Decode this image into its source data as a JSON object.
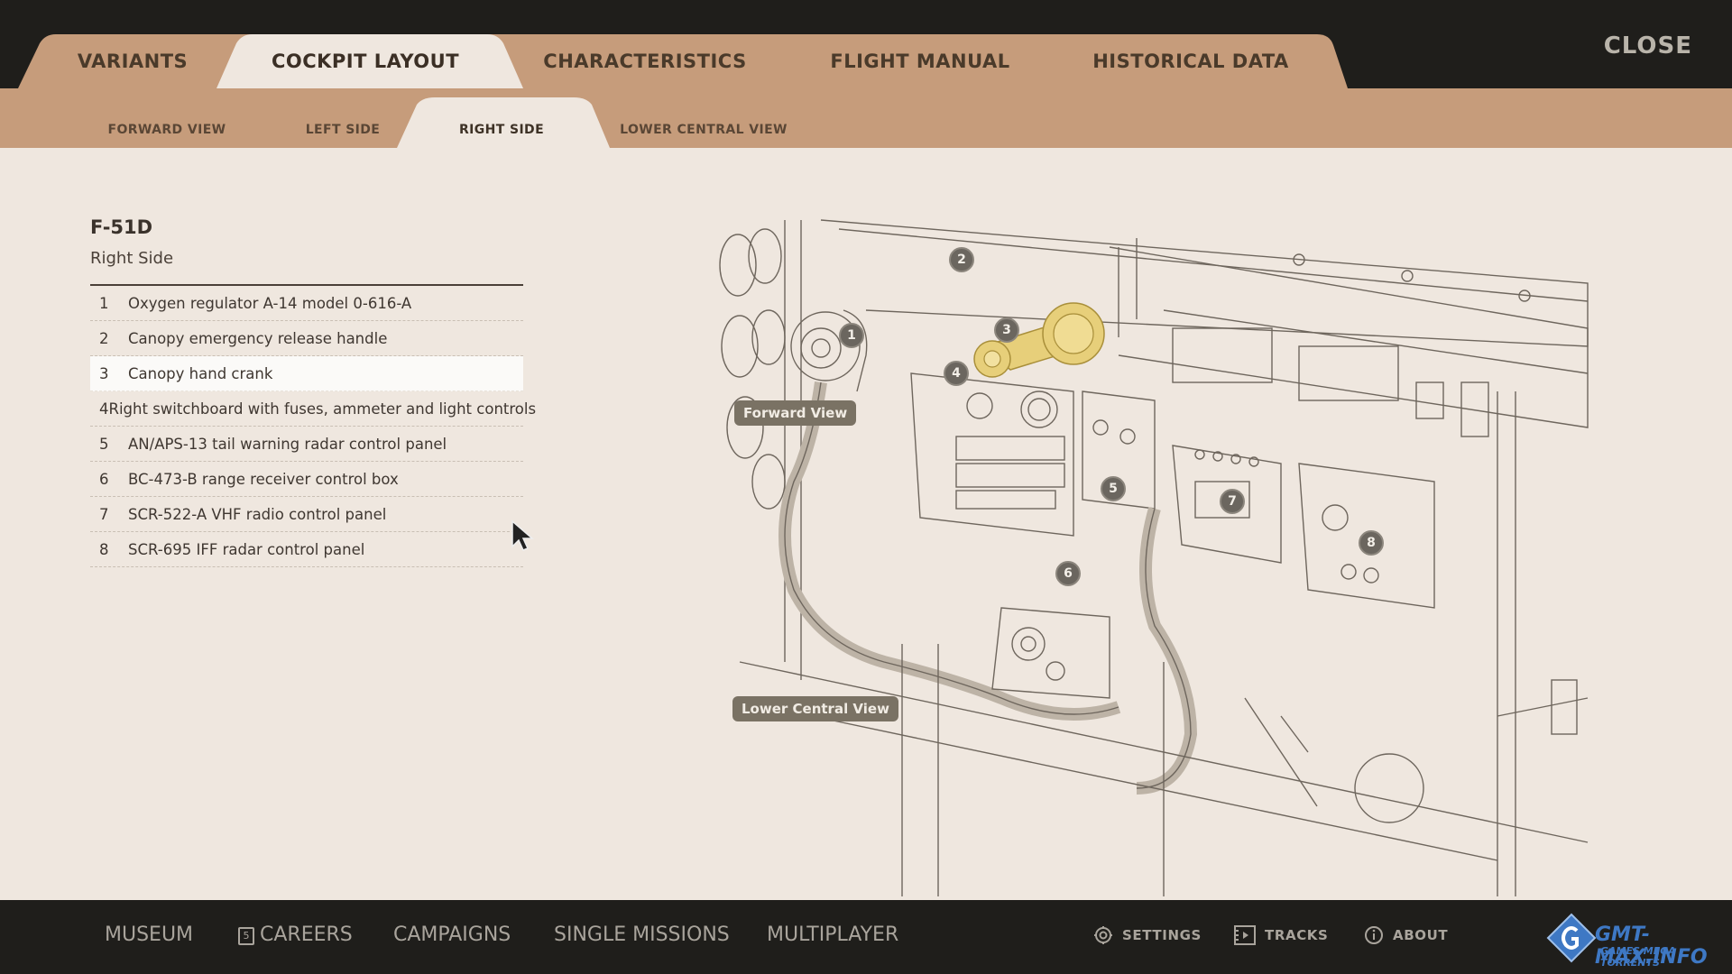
{
  "header": {
    "tabs": [
      {
        "label": "VARIANTS",
        "active": false
      },
      {
        "label": "COCKPIT LAYOUT",
        "active": true
      },
      {
        "label": "CHARACTERISTICS",
        "active": false
      },
      {
        "label": "FLIGHT MANUAL",
        "active": false
      },
      {
        "label": "HISTORICAL DATA",
        "active": false
      }
    ],
    "close_label": "CLOSE"
  },
  "subtabs": [
    {
      "label": "FORWARD VIEW",
      "active": false
    },
    {
      "label": "LEFT SIDE",
      "active": false
    },
    {
      "label": "RIGHT SIDE",
      "active": true
    },
    {
      "label": "LOWER CENTRAL VIEW",
      "active": false
    }
  ],
  "panel": {
    "aircraft": "F-51D",
    "view": "Right Side",
    "selected_index": 3,
    "items": [
      {
        "num": "1",
        "label": "Oxygen regulator A-14 model 0-616-A"
      },
      {
        "num": "2",
        "label": "Canopy emergency release handle"
      },
      {
        "num": "3",
        "label": "Canopy hand crank"
      },
      {
        "num": "4",
        "label": "Right switchboard with fuses, ammeter and light controls"
      },
      {
        "num": "5",
        "label": "AN/APS-13 tail warning radar control panel"
      },
      {
        "num": "6",
        "label": "BC-473-B range receiver control box"
      },
      {
        "num": "7",
        "label": "SCR-522-A VHF radio control panel"
      },
      {
        "num": "8",
        "label": "SCR-695 IFF radar control panel"
      }
    ]
  },
  "diagram": {
    "nav_forward": "Forward View",
    "nav_lower": "Lower Central View",
    "markers": [
      "1",
      "2",
      "3",
      "4",
      "5",
      "6",
      "7",
      "8"
    ],
    "highlight_color": "#e7cf7a"
  },
  "footer": {
    "nav": [
      "MUSEUM",
      "CAREERS",
      "CAMPAIGNS",
      "SINGLE MISSIONS",
      "MULTIPLAYER"
    ],
    "careers_badge": "5",
    "system": [
      {
        "label": "SETTINGS",
        "icon": "gear-icon"
      },
      {
        "label": "TRACKS",
        "icon": "film-icon"
      },
      {
        "label": "ABOUT",
        "icon": "info-icon"
      }
    ],
    "watermark_text": "GMT-MAX.INFO",
    "watermark_sub": "GAMES MEGA TORRENTS"
  },
  "colors": {
    "tab_bg": "#c69c7b",
    "active_tab_bg": "#efe7df",
    "bars_bg": "#1f1e1b",
    "content_bg": "#efe7df"
  }
}
